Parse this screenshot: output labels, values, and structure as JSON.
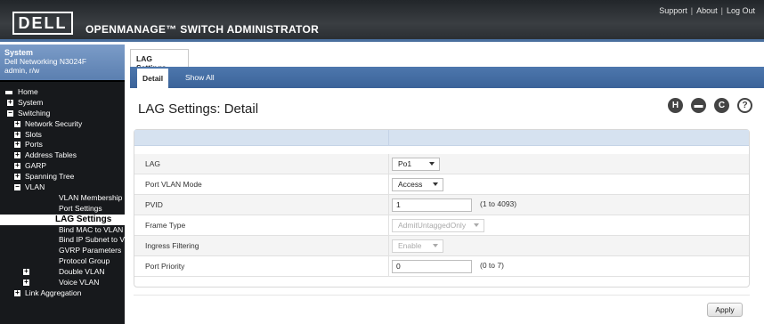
{
  "header": {
    "brand": "DELL",
    "app_title": "OPENMANAGE™ SWITCH ADMINISTRATOR",
    "links": [
      "Support",
      "About",
      "Log Out"
    ]
  },
  "sidebar": {
    "system_title": "System",
    "device": "Dell Networking N3024F",
    "user": "admin, r/w",
    "tree": [
      {
        "label": "Home",
        "level": 0,
        "icon": "home-icon"
      },
      {
        "label": "System",
        "level": 0,
        "icon": "expand-plus-icon"
      },
      {
        "label": "Switching",
        "level": 0,
        "icon": "collapse-minus-icon"
      },
      {
        "label": "Network Security",
        "level": 1,
        "icon": "expand-plus-icon"
      },
      {
        "label": "Slots",
        "level": 1,
        "icon": "expand-plus-icon"
      },
      {
        "label": "Ports",
        "level": 1,
        "icon": "expand-plus-icon"
      },
      {
        "label": "Address Tables",
        "level": 1,
        "icon": "expand-plus-icon"
      },
      {
        "label": "GARP",
        "level": 1,
        "icon": "expand-plus-icon"
      },
      {
        "label": "Spanning Tree",
        "level": 1,
        "icon": "expand-plus-icon"
      },
      {
        "label": "VLAN",
        "level": 1,
        "icon": "collapse-minus-icon"
      },
      {
        "label": "VLAN Membership",
        "level": 2,
        "icon": ""
      },
      {
        "label": "Port Settings",
        "level": 2,
        "icon": ""
      },
      {
        "label": "LAG Settings",
        "level": 2,
        "icon": "",
        "selected": true
      },
      {
        "label": "Bind MAC to VLAN",
        "level": 2,
        "icon": ""
      },
      {
        "label": "Bind IP Subnet to VLAN",
        "level": 2,
        "icon": ""
      },
      {
        "label": "GVRP Parameters",
        "level": 2,
        "icon": ""
      },
      {
        "label": "Protocol Group",
        "level": 2,
        "icon": ""
      },
      {
        "label": "Double VLAN",
        "level": 2,
        "icon": "expand-plus-icon"
      },
      {
        "label": "Voice VLAN",
        "level": 2,
        "icon": "expand-plus-icon"
      },
      {
        "label": "Link Aggregation",
        "level": 1,
        "icon": "expand-plus-icon"
      }
    ]
  },
  "tabs": {
    "main": "LAG Settings",
    "sub": [
      "Detail",
      "Show All"
    ]
  },
  "page": {
    "title": "LAG Settings: Detail",
    "toolbar_icons": [
      {
        "name": "help-hint-icon",
        "glyph": "H"
      },
      {
        "name": "print-icon",
        "glyph": "▬"
      },
      {
        "name": "refresh-icon",
        "glyph": "C"
      },
      {
        "name": "help-icon",
        "glyph": "?"
      }
    ]
  },
  "form": {
    "lag_label": "LAG",
    "lag_value": "Po1",
    "port_vlan_mode_label": "Port VLAN Mode",
    "port_vlan_mode_value": "Access",
    "pvid_label": "PVID",
    "pvid_value": "1",
    "pvid_hint": "(1 to 4093)",
    "frame_type_label": "Frame Type",
    "frame_type_value": "AdmitUntaggedOnly",
    "ingress_filtering_label": "Ingress Filtering",
    "ingress_filtering_value": "Enable",
    "port_priority_label": "Port Priority",
    "port_priority_value": "0",
    "port_priority_hint": "(0 to 7)"
  },
  "actions": {
    "apply_label": "Apply"
  },
  "colors": {
    "header_bg": "#2b2f33",
    "accent_blue": "#3b6399",
    "table_header": "#d6e2f0"
  }
}
